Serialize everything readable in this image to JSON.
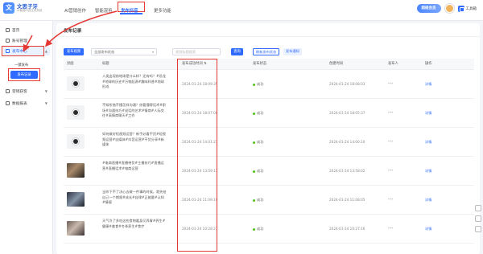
{
  "app": {
    "name": "文思子牙",
    "subtitle": "AI营销内容生成系统",
    "logo_mark": "文"
  },
  "top_nav": {
    "items": [
      "AI营销创作",
      "智能混剪",
      "发布抖音",
      "更多功能"
    ],
    "active": "发布抖音"
  },
  "header": {
    "vip_label": "超级会员",
    "tool_label": "工具箱"
  },
  "sidebar": {
    "items": [
      "首页",
      "账号管理",
      "发布中心",
      "营销获客",
      "数据报表"
    ],
    "sub_items": [
      "一键发布",
      "发布记录"
    ],
    "active": "发布中心",
    "active_sub": "发布记录"
  },
  "page": {
    "title": "发布记录"
  },
  "toolbar": {
    "publish_button": "发布视频",
    "status_select": "全部发布状态",
    "search_placeholder": "视频标题搜索",
    "search_button": "查询",
    "refresh_button": "刷新发布状态",
    "notice_button": "发布通知"
  },
  "table": {
    "columns": [
      "封面",
      "标题",
      "发布成功时间",
      "发布状态",
      "创建时间",
      "发布人",
      "操作"
    ],
    "rows": [
      {
        "title": "人类出现前地球是什么样？还有吗？#恐龙#地球的历史#万物起源#趣味科普#地球形成",
        "publish_time": "2024-01-24 18:09:35",
        "status": "成功",
        "created": "2024-01-24 18:08:03",
        "publisher": "***",
        "action": "详情"
      },
      {
        "title": "不知所措不懂怎样沟通？你要懂得话术#职场#沟通技巧#说话的艺术#情商#人际交往#高情商聊天#工作",
        "publish_time": "2024-01-24 18:07:00",
        "status": "成功",
        "created": "2024-01-24 18:05:37",
        "publisher": "***",
        "action": "详情"
      },
      {
        "title": "如何做好短视频运营？新手必看干货#短视频运营#自媒体#抖音运营#干货分享#新媒体",
        "publish_time": "2024-01-24 14:01:21",
        "status": "成功",
        "created": "2024-01-24 14:00:10",
        "publisher": "***",
        "action": "详情"
      },
      {
        "title": "#电商直播#直播带货#主播技巧#直播运营#直播话术#电商运营",
        "publish_time": "2024-01-24 13:59:11",
        "status": "成功",
        "created": "2024-01-24 13:58:02",
        "publisher": "***",
        "action": "详情"
      },
      {
        "title": "当你下不了决心去做一件事的时候，就先给自己一个期限#成长#自律#正能量#认知#情感",
        "publish_time": "2024-01-24 11:09:10",
        "status": "成功",
        "created": "2024-01-24 11:08:05",
        "publisher": "***",
        "action": "详情"
      },
      {
        "title": "天气冷了多吃这些食物暖身又养胃#养生#健康#美食#冬季养生#食疗",
        "publish_time": "2024-01-24 10:28:27",
        "status": "成功",
        "created": "2024-01-24 10:27:16",
        "publisher": "***",
        "action": "详情"
      }
    ]
  },
  "colors": {
    "accent": "#2f6bff",
    "highlight": "#e53935",
    "success": "#52c41a"
  }
}
